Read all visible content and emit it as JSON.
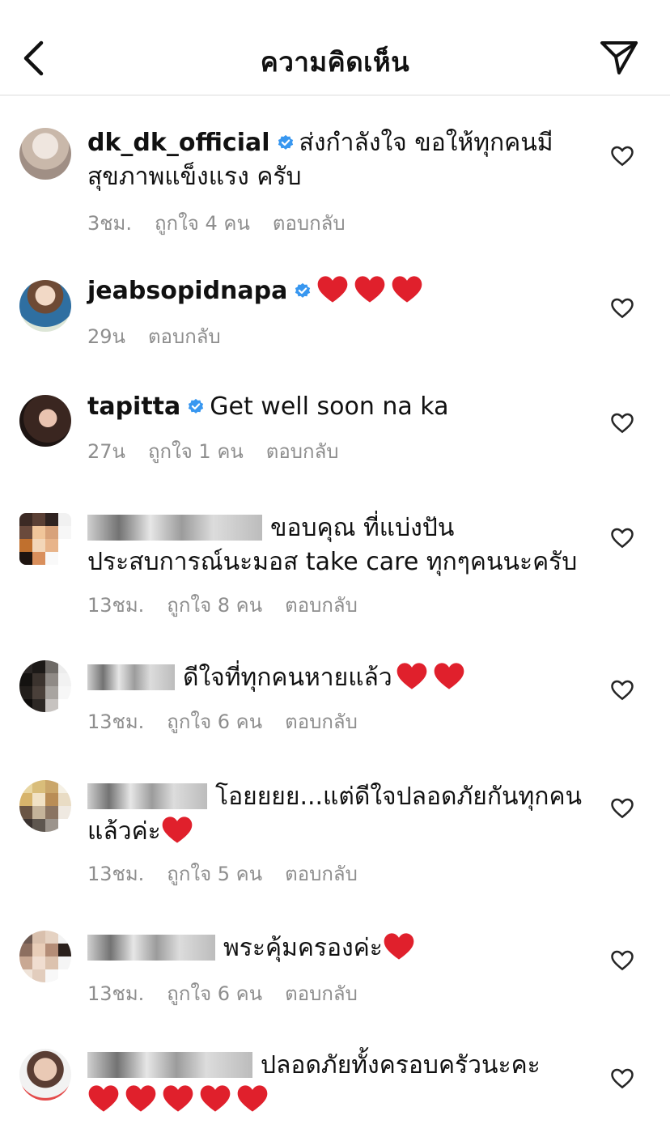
{
  "header": {
    "title": "ความคิดเห็น"
  },
  "labels": {
    "reply": "ตอบกลับ"
  },
  "comments": [
    {
      "username": "dk_dk_official",
      "text": "ส่งกำลังใจ ขอให้ทุกคนมีสุขภาพแข็งแรง ครับ",
      "time": "3ชม.",
      "likes": "ถูกใจ 4 คน"
    },
    {
      "username": "jeabsopidnapa",
      "text": "",
      "time": "29น",
      "likes": ""
    },
    {
      "username": "tapitta",
      "text": "Get well soon na ka",
      "time": "27น",
      "likes": "ถูกใจ 1 คน"
    },
    {
      "username": "",
      "text": "ขอบคุณ ที่แบ่งปันประสบการณ์นะมอส take care ทุกๆคนนะครับ",
      "time": "13ชม.",
      "likes": "ถูกใจ 8 คน"
    },
    {
      "username": "",
      "text": "ดีใจที่ทุกคนหายแล้ว",
      "time": "13ชม.",
      "likes": "ถูกใจ 6 คน"
    },
    {
      "username": "",
      "text": "โอยยยย...แต่ดีใจปลอดภัยกันทุกคนแล้วค่ะ",
      "time": "13ชม.",
      "likes": "ถูกใจ 5 คน"
    },
    {
      "username": "",
      "text": "พระคุ้มครองค่ะ",
      "time": "13ชม.",
      "likes": "ถูกใจ 6 คน"
    },
    {
      "username": "",
      "text": "ปลอดภัยทั้งครอบครัวนะคะ",
      "time": "",
      "likes": ""
    }
  ],
  "colors": {
    "verified": "#3897f0",
    "heart_emoji": "#e0202c",
    "meta_gray": "#8e8e8e"
  },
  "icons": {
    "back": "chevron-left-icon",
    "send": "paper-plane-icon",
    "like": "heart-outline-icon",
    "verified": "verified-badge-icon"
  }
}
